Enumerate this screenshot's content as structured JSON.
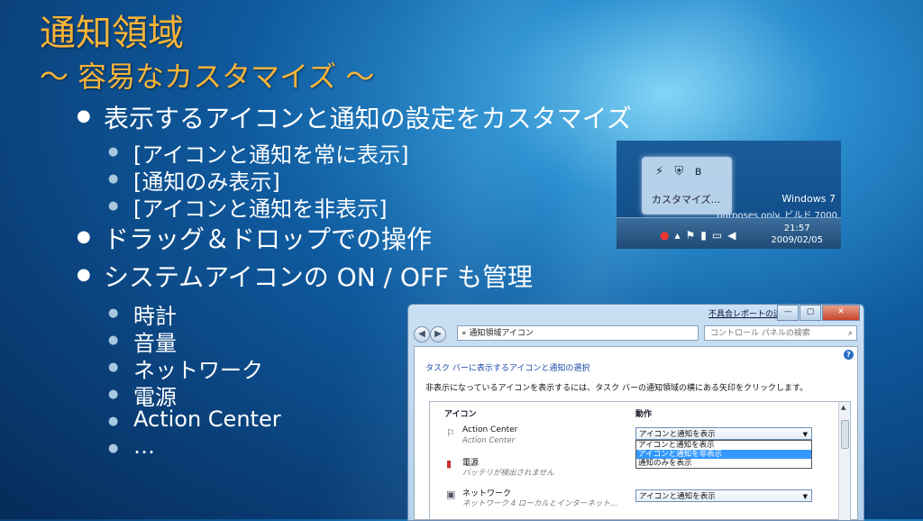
{
  "slide": {
    "title": "通知領域",
    "subtitle": "～ 容易なカスタマイズ ～",
    "bullets": [
      "表示するアイコンと通知の設定をカスタマイズ",
      "ドラッグ＆ドロップでの操作",
      "システムアイコンの ON / OFF も管理"
    ],
    "sub1": [
      "[アイコンと通知を常に表示]",
      "[通知のみ表示]",
      "[アイコンと通知を非表示]"
    ],
    "sub2": [
      "時計",
      "音量",
      "ネットワーク",
      "電源",
      "Action Center",
      "…"
    ]
  },
  "tray": {
    "customize": "カスタマイズ...",
    "watermark1": "Windows 7",
    "watermark2": "purposes only. ビルド 7000",
    "time": "21:57",
    "date": "2009/02/05"
  },
  "dialog": {
    "feedback": "不具合レポートの送信",
    "address": "« 通知領域アイコン",
    "search_placeholder": "コントロール パネルの検索",
    "heading": "タスク バーに表示するアイコンと通知の選択",
    "description": "非表示になっているアイコンを表示するには、タスク バーの通知領域の横にある矢印をクリックします。",
    "col_icon": "アイコン",
    "col_action": "動作",
    "rows": [
      {
        "name": "Action Center",
        "sub": "Action Center",
        "value": "アイコンと通知を表示"
      },
      {
        "name": "電源",
        "sub": "バッテリが検出されません",
        "value": ""
      },
      {
        "name": "ネットワーク",
        "sub": "ネットワーク 4 ローカルとインターネット...",
        "value": "アイコンと通知を表示"
      }
    ],
    "options": [
      "アイコンと通知を表示",
      "アイコンと通知を非表示",
      "通知のみを表示"
    ]
  }
}
